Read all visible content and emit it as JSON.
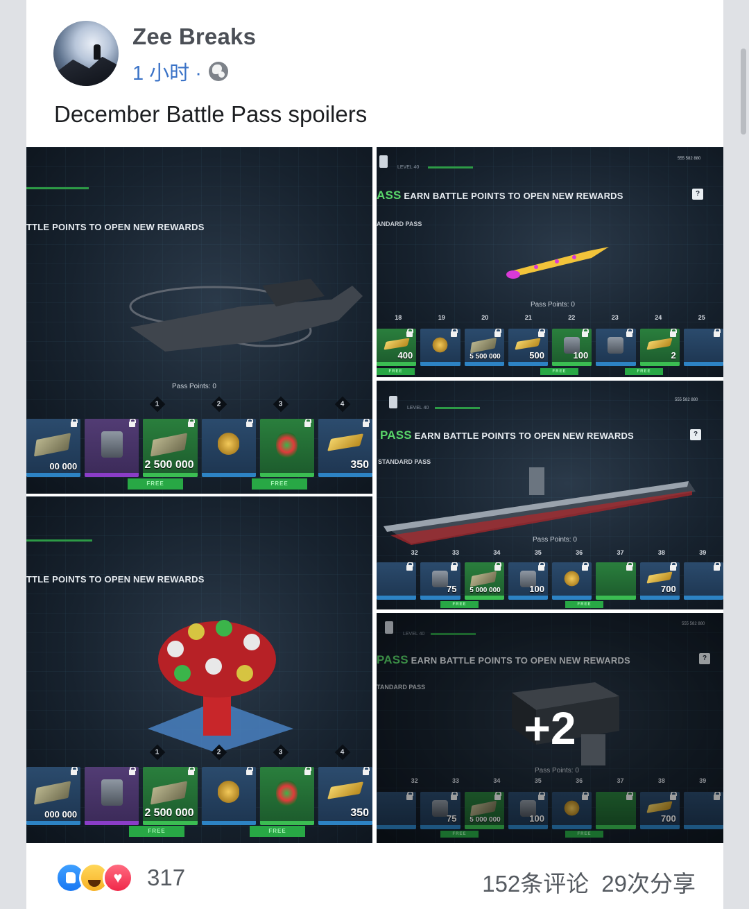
{
  "post": {
    "author": "Zee Breaks",
    "time": "1 小时 ·",
    "text": "December Battle Pass spoilers"
  },
  "photos": {
    "p1": {
      "header": "TTLE POINTS TO OPEN NEW REWARDS",
      "pass_points": "Pass Points: 0",
      "ticks": [
        "1",
        "2",
        "3",
        "4"
      ],
      "items": [
        {
          "qty": "00 000"
        },
        {
          "qty": ""
        },
        {
          "qty": "2 500 000",
          "free": "FREE"
        },
        {
          "qty": ""
        },
        {
          "qty": "",
          "free": "FREE"
        },
        {
          "qty": "350"
        }
      ]
    },
    "p2": {
      "header": "TTLE POINTS TO OPEN NEW REWARDS",
      "ticks": [
        "1",
        "2",
        "3",
        "4"
      ],
      "items": [
        {
          "qty": "000 000"
        },
        {
          "qty": ""
        },
        {
          "qty": "2 500 000",
          "free": "FREE"
        },
        {
          "qty": ""
        },
        {
          "qty": "",
          "free": "FREE"
        },
        {
          "qty": "350"
        }
      ]
    },
    "p3": {
      "accent": "ASS",
      "header": "EARN BATTLE POINTS TO OPEN NEW REWARDS",
      "sub": "ANDARD PASS",
      "level": "LEVEL 40",
      "money": "555 582 880",
      "help": "?",
      "pass_points": "Pass Points: 0",
      "ticks": [
        "18",
        "19",
        "20",
        "21",
        "22",
        "23",
        "24",
        "25"
      ],
      "items": [
        {
          "qty": "400",
          "free": "FREE"
        },
        {
          "qty": ""
        },
        {
          "qty": "5 500 000"
        },
        {
          "qty": "500"
        },
        {
          "qty": "100",
          "free": "FREE"
        },
        {
          "qty": ""
        },
        {
          "qty": "2",
          "free": "FREE"
        },
        {
          "qty": ""
        }
      ]
    },
    "p4": {
      "accent": "PASS",
      "header": "EARN BATTLE POINTS TO OPEN NEW REWARDS",
      "sub": "STANDARD PASS",
      "level": "LEVEL 40",
      "money": "555 582 880",
      "help": "?",
      "pass_points": "Pass Points: 0",
      "ticks": [
        "32",
        "33",
        "34",
        "35",
        "36",
        "37",
        "38",
        "39"
      ],
      "items": [
        {
          "qty": "75"
        },
        {
          "qty": "5 000 000",
          "free": "FREE"
        },
        {
          "qty": "100"
        },
        {
          "qty": ""
        },
        {
          "qty": "",
          "free": "FREE"
        },
        {
          "qty": "700"
        },
        {
          "qty": ""
        },
        {
          "qty": ""
        }
      ]
    },
    "p5": {
      "accent": "PASS",
      "header": "EARN BATTLE POINTS TO OPEN NEW REWARDS",
      "sub": "TANDARD PASS",
      "level": "LEVEL 40",
      "money": "555 582 880",
      "help": "?",
      "pass_points": "Pass Points: 0",
      "more": "+2",
      "ticks": [
        "32",
        "33",
        "34",
        "35",
        "36",
        "37",
        "38",
        "39"
      ],
      "items": [
        {
          "qty": "75"
        },
        {
          "qty": "5 000 000",
          "free": "FREE"
        },
        {
          "qty": "100"
        },
        {
          "qty": ""
        },
        {
          "qty": "",
          "free": "FREE"
        },
        {
          "qty": "700"
        },
        {
          "qty": ""
        },
        {
          "qty": ""
        }
      ]
    }
  },
  "footer": {
    "reaction_count": "317",
    "comments": "152条评论",
    "shares": "29次分享"
  },
  "icons": [
    "like-icon",
    "haha-icon",
    "love-icon",
    "globe-icon",
    "lock-icon"
  ]
}
